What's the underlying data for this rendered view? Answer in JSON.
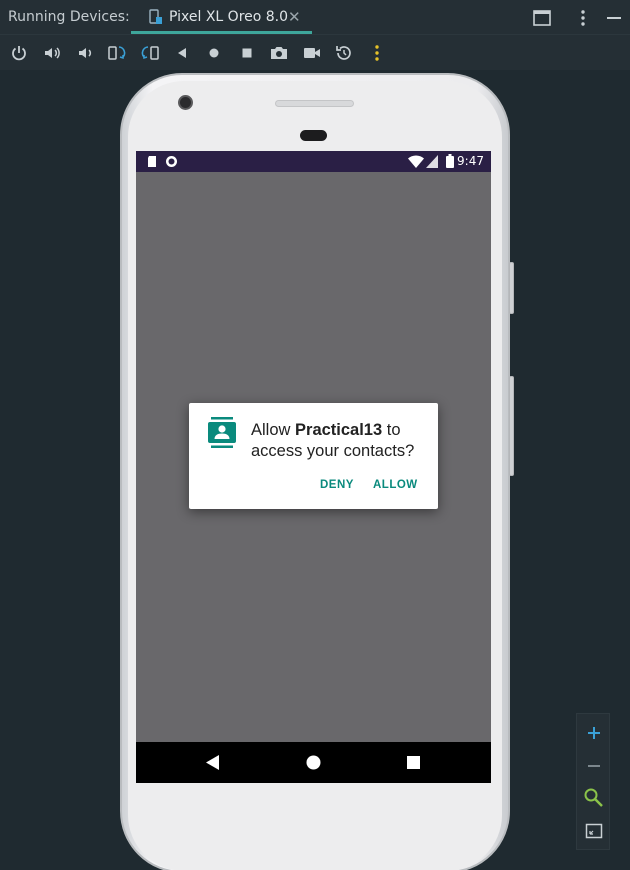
{
  "header": {
    "running_devices_label": "Running Devices:",
    "tab": {
      "label": "Pixel XL Oreo 8.0",
      "close_symbol": "✕",
      "icon": "device-icon"
    },
    "right_icons": [
      "window-layout-icon",
      "more-vertical-icon",
      "minimize-icon"
    ]
  },
  "toolbar": {
    "icons": [
      "power-icon",
      "volume-up-icon",
      "volume-down-icon",
      "rotate-left-icon",
      "rotate-right-icon",
      "back-icon",
      "home-icon",
      "overview-icon",
      "screenshot-icon",
      "screen-record-icon",
      "snapshot-icon",
      "more-options-icon"
    ]
  },
  "device": {
    "status_bar": {
      "time": "9:47",
      "left_icons": [
        "sd-card-icon",
        "sync-circle-icon"
      ],
      "right_icons": [
        "wifi-icon",
        "signal-icon",
        "battery-icon"
      ],
      "background": "#2a1f45"
    },
    "screen_background": "#69686b",
    "navigation": [
      "nav-back-icon",
      "nav-home-icon",
      "nav-recents-icon"
    ]
  },
  "dialog": {
    "icon": "contacts-icon",
    "message_prefix": "Allow ",
    "app_name": "Practical13",
    "message_suffix": " to access your contacts?",
    "deny_label": "DENY",
    "allow_label": "ALLOW",
    "accent_color": "#0a8a7d"
  },
  "zoom_controls": [
    "zoom-in-icon",
    "zoom-out-icon",
    "zoom-actual-icon",
    "fit-screen-icon"
  ]
}
